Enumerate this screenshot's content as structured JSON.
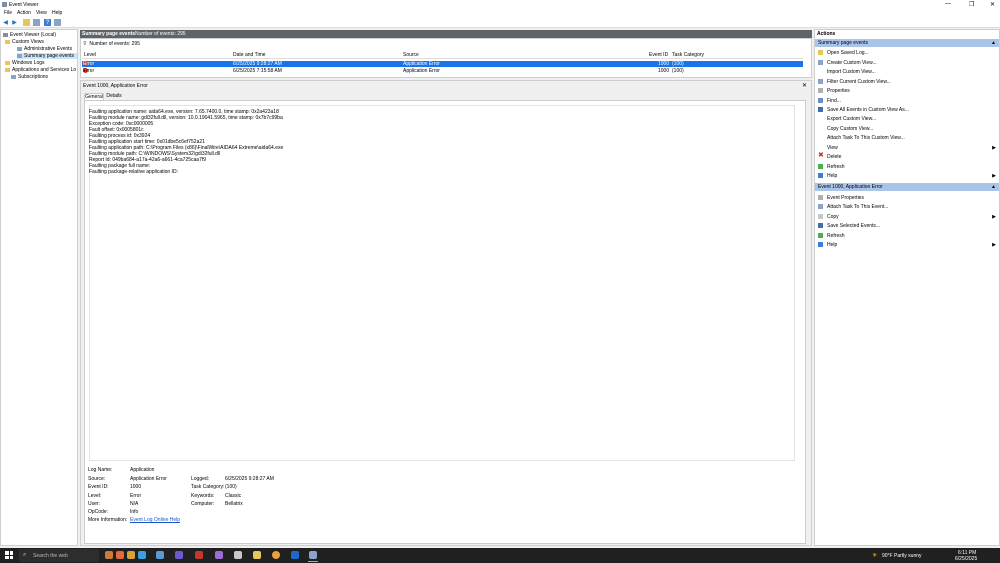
{
  "window": {
    "title": "Event Viewer",
    "minimize": "—",
    "maximize": "❐",
    "close": "✕"
  },
  "menu": [
    "File",
    "Action",
    "View",
    "Help"
  ],
  "tree": {
    "root": "Event Viewer (Local)",
    "custom_views": "Custom Views",
    "admin_events": "Administrative Events",
    "summary_page_events": "Summary page events",
    "windows_logs": "Windows Logs",
    "apps_services": "Applications and Services Lo",
    "subscriptions": "Subscriptions"
  },
  "header": {
    "title": "Summary page events",
    "count": "Number of events: 295"
  },
  "filter_bar": {
    "label": "Number of events: 295"
  },
  "columns": [
    "Level",
    "Date and Time",
    "Source",
    "Event ID",
    "Task Category"
  ],
  "rows": [
    {
      "level": "Error",
      "date": "6/25/2025 9:28:27 AM",
      "source": "Application Error",
      "event_id": "1000",
      "task": "(100)"
    },
    {
      "level": "Error",
      "date": "6/25/2025 7:15:58 AM",
      "source": "Application Error",
      "event_id": "1000",
      "task": "(100)"
    }
  ],
  "detail": {
    "title": "Event 1000, Application Error",
    "close": "✕",
    "tabs": [
      "General",
      "Details"
    ],
    "description": [
      "Faulting application name: aida64.exe, version: 7.65.7400.0, time stamp: 0x2a423a18",
      "Faulting module name: gdi32full.dll, version: 10.0.19041.5965, time stamp: 0x7b7c99ba",
      "Exception code: 0xc0000005",
      "Fault offset: 0x0005801c",
      "Faulting process id: 0x3924",
      "Faulting application start time: 0x01dbe5c6ef752a21",
      "Faulting application path: C:\\Program Files (x86)\\FinalWire\\AIDA64 Extreme\\aida64.exe",
      "Faulting module path: C:\\WINDOWS\\System32\\gdi32full.dll",
      "Report Id: 049ba684-a17a-42a6-a661-4ca725caa7f9",
      "Faulting package full name:",
      "Faulting package-relative application ID:"
    ],
    "fields": {
      "log_name_label": "Log Name:",
      "log_name": "Application",
      "source_label": "Source:",
      "source": "Application Error",
      "logged_label": "Logged:",
      "logged": "6/25/2025 9:28:27 AM",
      "event_id_label": "Event ID:",
      "event_id": "1000",
      "task_label": "Task Category:",
      "task": "(100)",
      "level_label": "Level:",
      "level": "Error",
      "keywords_label": "Keywords:",
      "keywords": "Classic",
      "user_label": "User:",
      "user": "N/A",
      "computer_label": "Computer:",
      "computer": "Bellatrix",
      "opcode_label": "OpCode:",
      "opcode": "Info",
      "more_info_label": "More Information:",
      "more_info": "Event Log Online Help"
    }
  },
  "actions": {
    "title": "Actions",
    "section1": "Summary page events",
    "section1_items": [
      "Open Saved Log...",
      "Create Custom View...",
      "Import Custom View...",
      "Filter Current Custom View...",
      "Properties",
      "Find...",
      "Save All Events in Custom View As...",
      "Export Custom View...",
      "Copy Custom View...",
      "Attach Task To This Custom View...",
      "View",
      "Delete",
      "Refresh",
      "Help"
    ],
    "section2": "Event 1000, Application Error",
    "section2_items": [
      "Event Properties",
      "Attach Task To This Event...",
      "Copy",
      "Save Selected Events...",
      "Refresh",
      "Help"
    ]
  },
  "taskbar": {
    "search": "Search the web",
    "weather": "90°F  Partly sunny",
    "time": "6:11 PM",
    "date": "6/25/2025"
  },
  "colors": {
    "header": "#5f6469",
    "selection": "#1a73e8",
    "section": "#a9c4e8",
    "taskbar": "#202020"
  }
}
